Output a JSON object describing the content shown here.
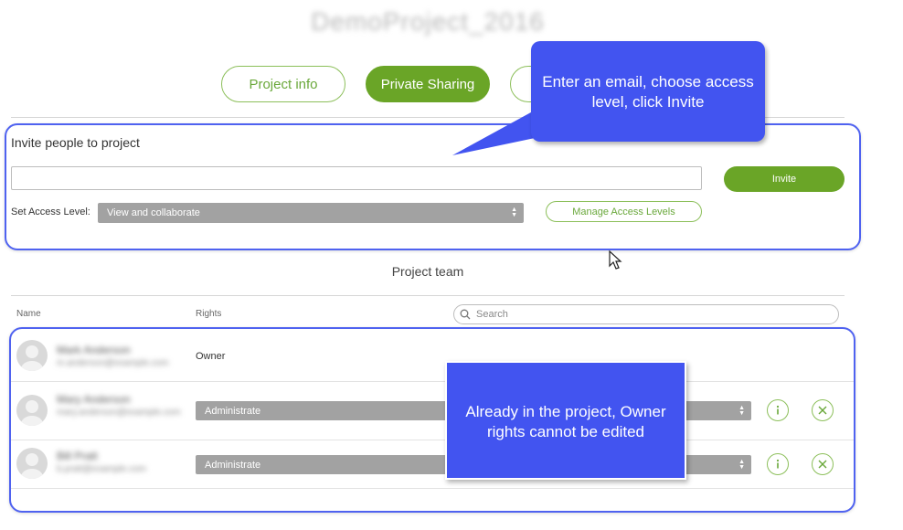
{
  "project": {
    "title": "DemoProject_2016"
  },
  "tabs": [
    {
      "label": "Project info"
    },
    {
      "label": "Private Sharing"
    }
  ],
  "invite": {
    "title": "Invite people to project",
    "email_value": "",
    "button_label": "Invite",
    "access_label": "Set Access Level:",
    "access_value": "View and collaborate",
    "manage_label": "Manage Access Levels"
  },
  "team": {
    "title": "Project team",
    "columns": {
      "name": "Name",
      "rights": "Rights"
    },
    "search_placeholder": "Search",
    "members": [
      {
        "name": "Mark Anderson",
        "email": "m.anderson@example.com",
        "rights": "Owner"
      },
      {
        "name": "Mary Anderson",
        "email": "mary.anderson@example.com",
        "rights": "Administrate"
      },
      {
        "name": "Bill Pratt",
        "email": "b.pratt@example.com",
        "rights": "Administrate"
      }
    ]
  },
  "callouts": {
    "invite_hint": "Enter an email, choose access level, click Invite",
    "owner_hint": "Already in the project, Owner rights cannot be edited"
  },
  "icons": {
    "info": "info-icon",
    "remove": "remove-icon",
    "search": "search-icon",
    "select_arrows": "select-arrows-icon",
    "cursor": "mouse-cursor-icon"
  },
  "colors": {
    "accent_green": "#6aa527",
    "highlight_blue": "#4f62f0",
    "callout_blue": "#4254f0"
  }
}
